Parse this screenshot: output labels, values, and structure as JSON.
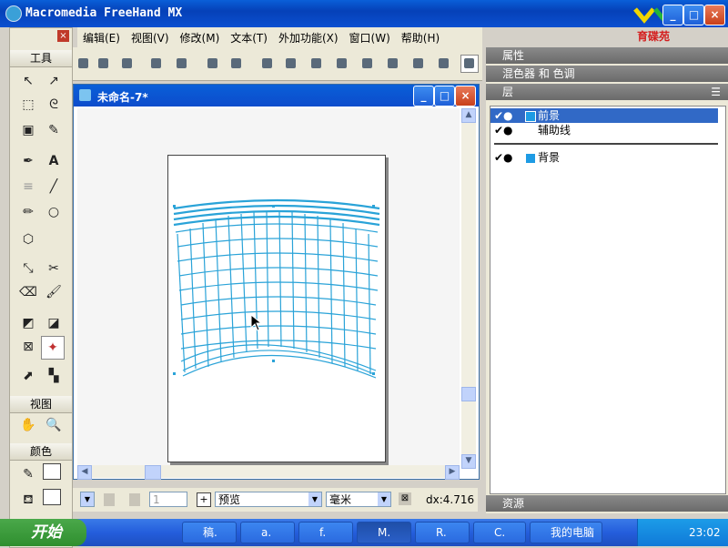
{
  "app": {
    "title": "Macromedia FreeHand MX"
  },
  "menus": [
    "编辑(E)",
    "视图(V)",
    "修改(M)",
    "文本(T)",
    "外加功能(X)",
    "窗口(W)",
    "帮助(H)"
  ],
  "tools_panel": {
    "title": "工具",
    "view_section": "视图",
    "color_section": "颜色"
  },
  "document": {
    "title": "未命名-7*"
  },
  "status": {
    "page_field": "1",
    "render_mode": "预览",
    "units": "毫米",
    "dx_readout": "dx:4.716"
  },
  "panels": {
    "properties": "属性",
    "mixer": "混色器 和 色调",
    "layers": "层",
    "assets": "资源",
    "layer_items": [
      {
        "name": "前景",
        "color": "#1e9be4",
        "selected": true
      },
      {
        "name": "辅助线",
        "color": "",
        "selected": false
      },
      {
        "name": "背景",
        "color": "#1e9be4",
        "selected": false
      }
    ]
  },
  "watermark": {
    "text": "育碟苑"
  },
  "taskbar": {
    "start_label": "开始",
    "tasks": [
      "稿.",
      "a.",
      "f.",
      "M.",
      "R.",
      "C.",
      "我的电脑"
    ],
    "clock": "23:02"
  },
  "colors": {
    "art": "#2aa3d8",
    "titlebar": "#0a5fd8",
    "layer_selected": "#3169c6"
  }
}
